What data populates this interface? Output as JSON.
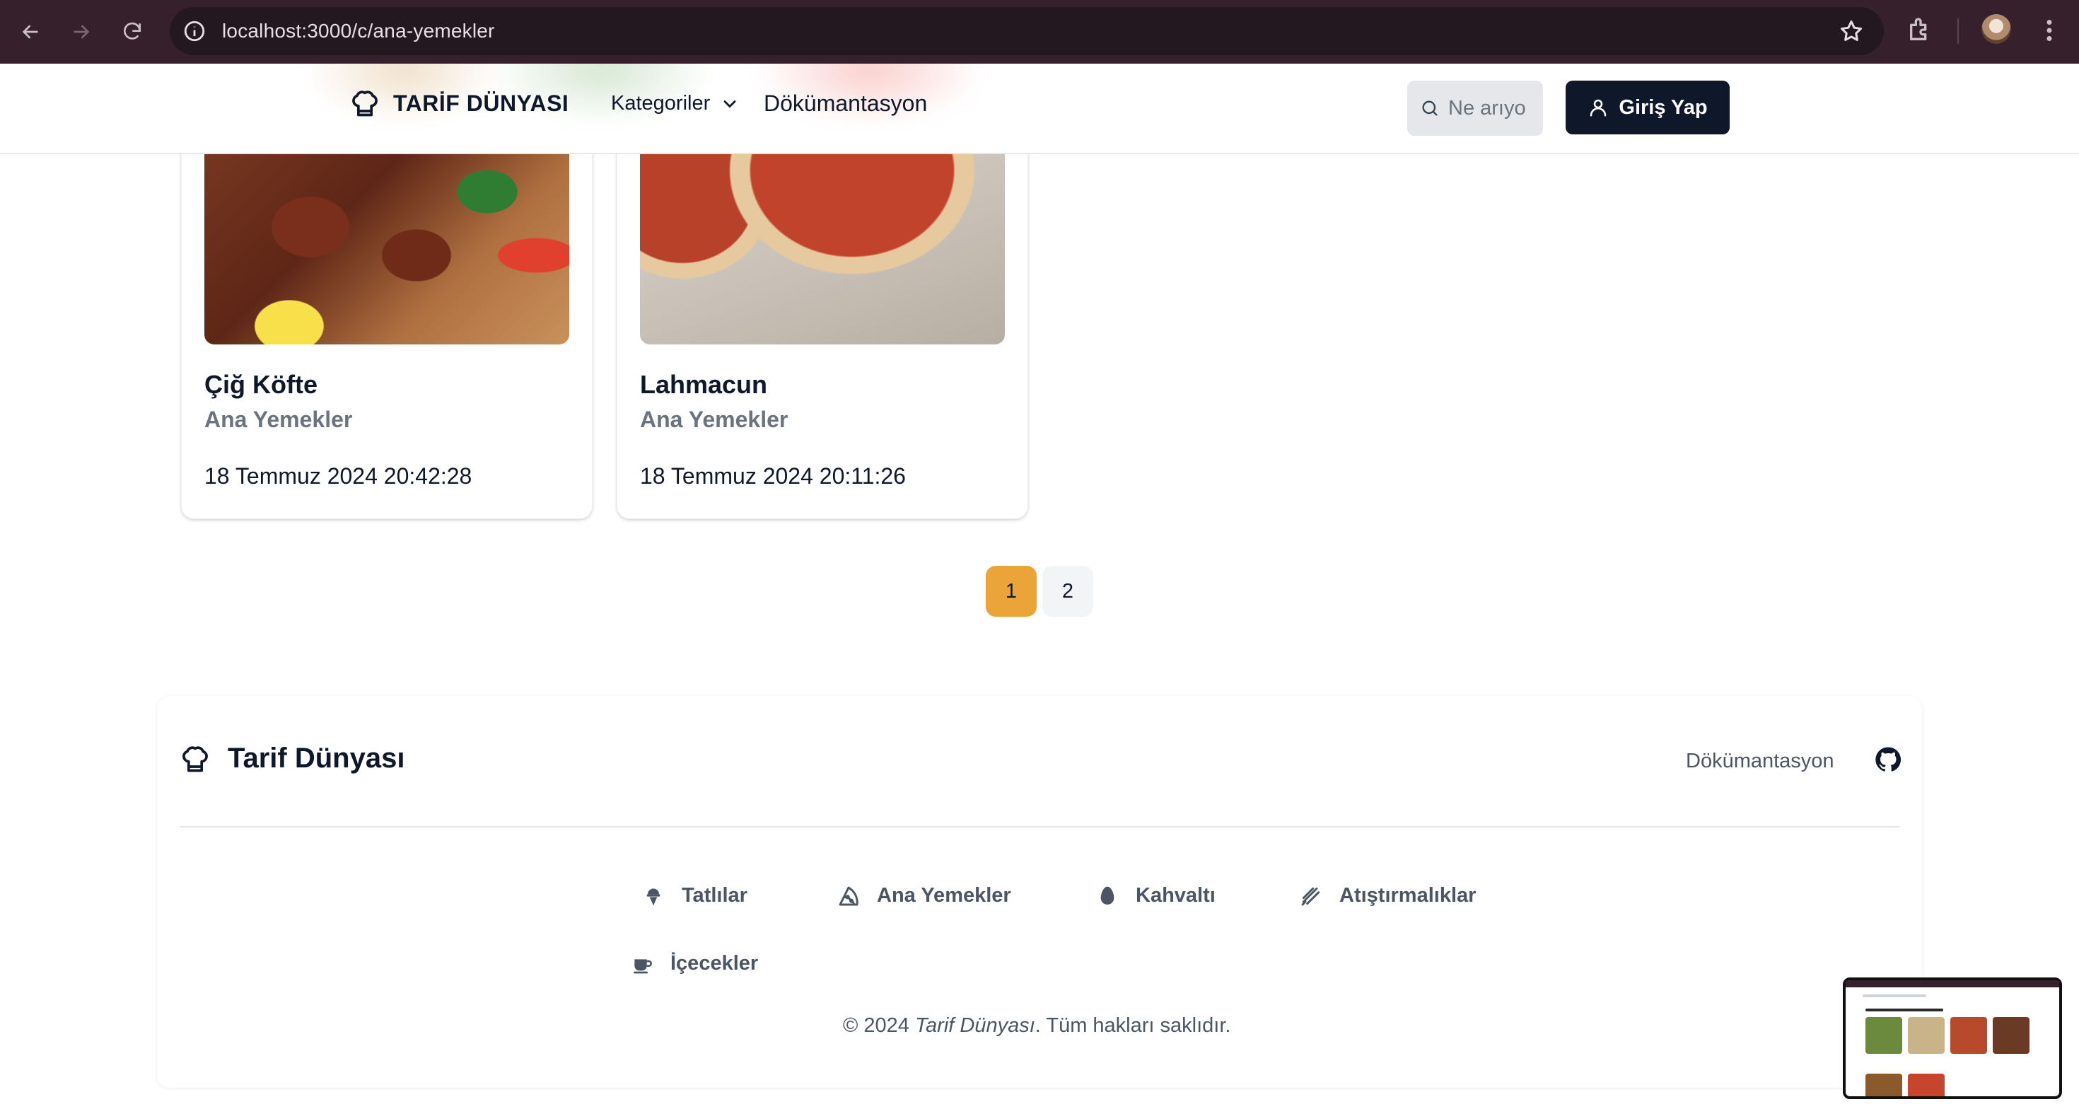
{
  "browser": {
    "url": "localhost:3000/c/ana-yemekler",
    "icons": [
      "back-icon",
      "forward-icon",
      "reload-icon",
      "info-icon",
      "star-icon",
      "extensions-icon",
      "profile-avatar",
      "menu-icon"
    ]
  },
  "header": {
    "brand": "TARİF DÜNYASI",
    "categories_label": "Kategoriler",
    "docs_label": "Dökümantasyon",
    "search_placeholder": "Ne arıyorsunuz?",
    "login_label": "Giriş Yap"
  },
  "recipes": [
    {
      "title": "Çiğ Köfte",
      "category": "Ana Yemekler",
      "date": "18 Temmuz 2024 20:42:28"
    },
    {
      "title": "Lahmacun",
      "category": "Ana Yemekler",
      "date": "18 Temmuz 2024 20:11:26"
    }
  ],
  "pagination": {
    "pages": [
      "1",
      "2"
    ],
    "current": "1"
  },
  "footer": {
    "brand": "Tarif Dünyası",
    "docs_label": "Dökümantasyon",
    "links": [
      "Tatlılar",
      "Ana Yemekler",
      "Kahvaltı",
      "Atıştırmalıklar",
      "İçecekler"
    ],
    "copyright_prefix": "© 2024 ",
    "copyright_brand": "Tarif Dünyası",
    "copyright_suffix": ". Tüm hakları saklıdır."
  },
  "colors": {
    "accent": "#eba437",
    "dark": "#0f172a",
    "muted": "#6b7280",
    "chrome": "#35202c"
  }
}
